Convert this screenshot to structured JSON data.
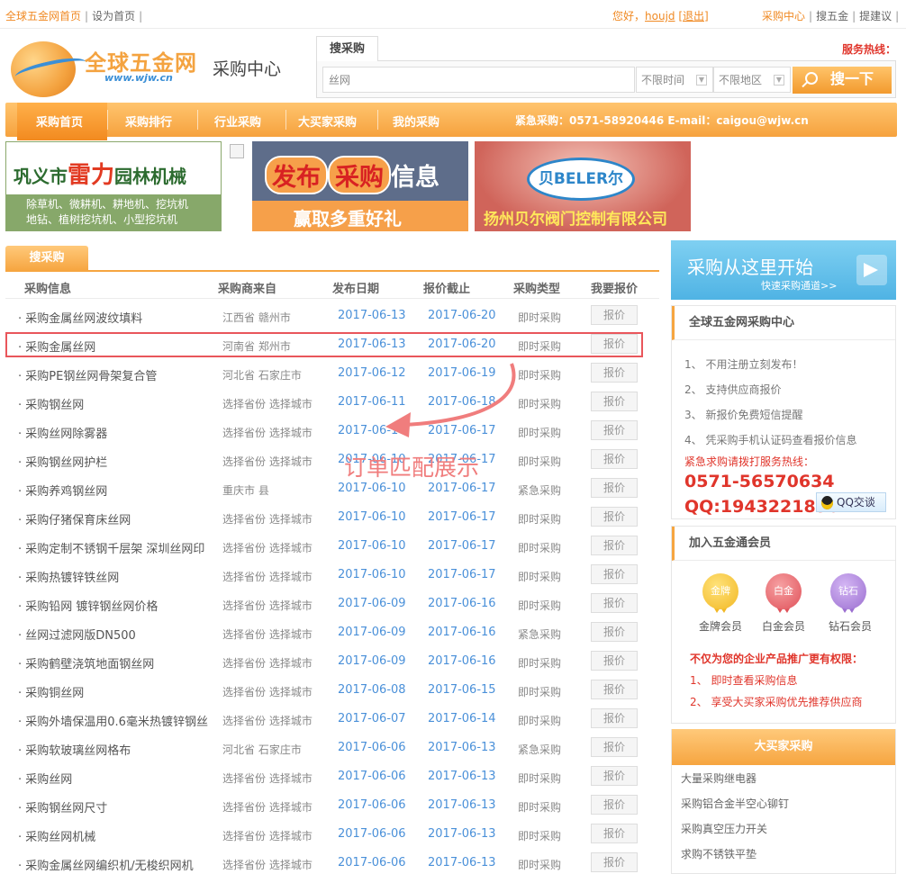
{
  "topbar": {
    "home": "全球五金网首页",
    "set_home": "设为首页",
    "hello": "您好，",
    "user": "houjd",
    "logout": "[退出]",
    "purchase_center": "采购中心",
    "search_wujin": "搜五金",
    "suggest": "提建议"
  },
  "logo": {
    "name": "全球五金网",
    "url": "www.wjw.cn"
  },
  "center_title": "采购中心",
  "search": {
    "tab": "搜采购",
    "value": "丝网",
    "time_select": "不限时间",
    "area_select": "不限地区",
    "button": "搜一下",
    "hotline_label": "服务热线："
  },
  "nav": {
    "items": [
      "采购首页",
      "采购排行",
      "行业采购",
      "大买家采购",
      "我的采购"
    ],
    "emergency": "紧急采购：0571-58920446 E-mail：caigou@wjw.cn"
  },
  "banners": {
    "b1": {
      "title_pre": "巩义市",
      "title_key": "雷力",
      "title_post": "园林机械",
      "line1": "除草机、微耕机、耕地机、挖坑机",
      "line2": "地钻、植树挖坑机、小型挖坑机"
    },
    "b2": {
      "pre": "发布",
      "key": "采购",
      "post": "信息",
      "sub": "赢取多重好礼"
    },
    "b3": {
      "logo": "贝BELER尔",
      "sub": "扬州贝尔阀门控制有限公司"
    }
  },
  "list": {
    "tab": "搜采购",
    "headers": [
      "采购信息",
      "采购商来自",
      "发布日期",
      "报价截止",
      "采购类型",
      "我要报价"
    ],
    "quote_label": "报价",
    "rows": [
      {
        "name": "· 采购金属丝网波纹填料",
        "origin": "江西省 赣州市",
        "date": "2017-06-13",
        "deadline": "2017-06-20",
        "type": "即时采购"
      },
      {
        "name": "· 采购金属丝网",
        "origin": "河南省 郑州市",
        "date": "2017-06-13",
        "deadline": "2017-06-20",
        "type": "即时采购"
      },
      {
        "name": "· 采购PE钢丝网骨架复合管",
        "origin": "河北省 石家庄市",
        "date": "2017-06-12",
        "deadline": "2017-06-19",
        "type": "即时采购"
      },
      {
        "name": "· 采购钢丝网",
        "origin": "选择省份 选择城市",
        "date": "2017-06-11",
        "deadline": "2017-06-18",
        "type": "即时采购"
      },
      {
        "name": "· 采购丝网除雾器",
        "origin": "选择省份 选择城市",
        "date": "2017-06-10",
        "deadline": "2017-06-17",
        "type": "即时采购"
      },
      {
        "name": "· 采购钢丝网护栏",
        "origin": "选择省份 选择城市",
        "date": "2017-06-10",
        "deadline": "2017-06-17",
        "type": "即时采购"
      },
      {
        "name": "· 采购养鸡钢丝网",
        "origin": "重庆市 县",
        "date": "2017-06-10",
        "deadline": "2017-06-17",
        "type": "紧急采购"
      },
      {
        "name": "· 采购仔猪保育床丝网",
        "origin": "选择省份 选择城市",
        "date": "2017-06-10",
        "deadline": "2017-06-17",
        "type": "即时采购"
      },
      {
        "name": "· 采购定制不锈钢千层架 深圳丝网印",
        "origin": "选择省份 选择城市",
        "date": "2017-06-10",
        "deadline": "2017-06-17",
        "type": "即时采购"
      },
      {
        "name": "· 采购热镀锌铁丝网",
        "origin": "选择省份 选择城市",
        "date": "2017-06-10",
        "deadline": "2017-06-17",
        "type": "即时采购"
      },
      {
        "name": "· 采购铅网 镀锌钢丝网价格",
        "origin": "选择省份 选择城市",
        "date": "2017-06-09",
        "deadline": "2017-06-16",
        "type": "即时采购"
      },
      {
        "name": "· 丝网过滤网版DN500",
        "origin": "选择省份 选择城市",
        "date": "2017-06-09",
        "deadline": "2017-06-16",
        "type": "紧急采购"
      },
      {
        "name": "· 采购鹤壁浇筑地面钢丝网",
        "origin": "选择省份 选择城市",
        "date": "2017-06-09",
        "deadline": "2017-06-16",
        "type": "即时采购"
      },
      {
        "name": "· 采购铜丝网",
        "origin": "选择省份 选择城市",
        "date": "2017-06-08",
        "deadline": "2017-06-15",
        "type": "即时采购"
      },
      {
        "name": "· 采购外墙保温用0.6毫米热镀锌钢丝",
        "origin": "选择省份 选择城市",
        "date": "2017-06-07",
        "deadline": "2017-06-14",
        "type": "即时采购"
      },
      {
        "name": "· 采购软玻璃丝网格布",
        "origin": "河北省 石家庄市",
        "date": "2017-06-06",
        "deadline": "2017-06-13",
        "type": "紧急采购"
      },
      {
        "name": "· 采购丝网",
        "origin": "选择省份 选择城市",
        "date": "2017-06-06",
        "deadline": "2017-06-13",
        "type": "即时采购"
      },
      {
        "name": "· 采购钢丝网尺寸",
        "origin": "选择省份 选择城市",
        "date": "2017-06-06",
        "deadline": "2017-06-13",
        "type": "即时采购"
      },
      {
        "name": "· 采购丝网机械",
        "origin": "选择省份 选择城市",
        "date": "2017-06-06",
        "deadline": "2017-06-13",
        "type": "即时采购"
      },
      {
        "name": "· 采购金属丝网编织机/无梭织网机",
        "origin": "选择省份 选择城市",
        "date": "2017-06-06",
        "deadline": "2017-06-13",
        "type": "即时采购"
      }
    ]
  },
  "annotation": {
    "text": "订单匹配展示",
    "color": "#f07d7d"
  },
  "sidebar": {
    "start": {
      "title": "采购从这里开始",
      "sub": "快速采购通道>>"
    },
    "center": {
      "title": "全球五金网采购中心",
      "items": [
        "1、 不用注册立刻发布！",
        "2、 支持供应商报价",
        "3、 新报价免费短信提醒",
        "4、 凭采购手机认证码查看报价信息"
      ],
      "emergency": "紧急求购请拨打服务热线：",
      "phone": "0571-56570634",
      "qq": "QQ:1943221896",
      "qq_button": "QQ交谈"
    },
    "member": {
      "title": "加入五金通会员",
      "medals": [
        {
          "badge": "金牌",
          "label": "金牌会员",
          "color": "#f2b824"
        },
        {
          "badge": "白金",
          "label": "白金会员",
          "color": "#e0525a"
        },
        {
          "badge": "钻石",
          "label": "钻石会员",
          "color": "#9b6fd0"
        }
      ],
      "highlight": "不仅为您的企业产品推广更有权限：",
      "perks": [
        "1、 即时查看采购信息",
        "2、 享受大买家采购优先推荐供应商"
      ]
    },
    "buyers": {
      "title": "大买家采购",
      "items": [
        "大量采购继电器",
        "采购铝合金半空心铆钉",
        "采购真空压力开关",
        "求购不锈铁平垫"
      ]
    }
  }
}
